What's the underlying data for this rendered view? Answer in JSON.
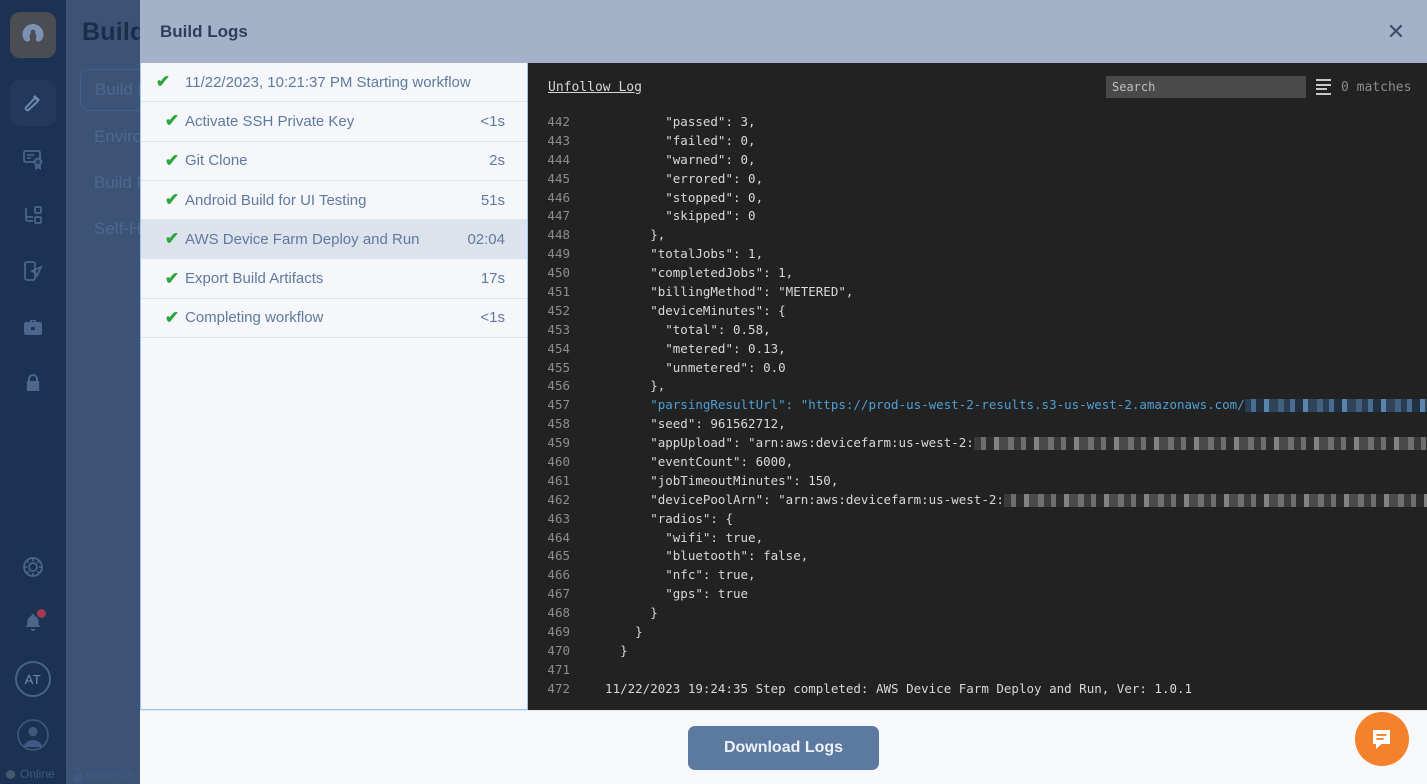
{
  "background": {
    "nav_title": "Build",
    "nav_items": [
      {
        "label": "Build Profiles",
        "name": "build-profiles"
      },
      {
        "label": "Environment Variables",
        "name": "environment-variables"
      },
      {
        "label": "Build History",
        "name": "build-history"
      },
      {
        "label": "Self-Hosted Runners",
        "name": "self-hosted-runners"
      }
    ],
    "rail_icons": [
      {
        "name": "appcircle-logo-icon"
      },
      {
        "name": "hammer-build-icon"
      },
      {
        "name": "signing-identities-icon"
      },
      {
        "name": "distribution-icon"
      },
      {
        "name": "testing-distribution-icon"
      },
      {
        "name": "enterprise-store-icon"
      },
      {
        "name": "security-lock-icon"
      },
      {
        "name": "settings-gear-icon"
      },
      {
        "name": "notifications-bell-icon"
      },
      {
        "name": "user-initials-avatar"
      },
      {
        "name": "account-avatar-icon"
      }
    ],
    "avatar_initials": "AT",
    "statusbar": {
      "online_label": "Online",
      "brand_label": "Appcircle"
    }
  },
  "modal": {
    "title": "Build Logs",
    "close_label": "✕",
    "footer": {
      "download_label": "Download Logs"
    }
  },
  "steps": [
    {
      "label": "11/22/2023, 10:21:37 PM Starting workflow",
      "duration": "",
      "header": true,
      "selected": false
    },
    {
      "label": "Activate SSH Private Key",
      "duration": "<1s",
      "header": false,
      "selected": false
    },
    {
      "label": "Git Clone",
      "duration": "2s",
      "header": false,
      "selected": false
    },
    {
      "label": "Android Build for UI Testing",
      "duration": "51s",
      "header": false,
      "selected": false
    },
    {
      "label": "AWS Device Farm Deploy and Run",
      "duration": "02:04",
      "header": false,
      "selected": true
    },
    {
      "label": "Export Build Artifacts",
      "duration": "17s",
      "header": false,
      "selected": false
    },
    {
      "label": "Completing workflow",
      "duration": "<1s",
      "header": false,
      "selected": false
    }
  ],
  "log_toolbar": {
    "unfollow_label": "Unfollow Log",
    "search_placeholder": "Search",
    "search_value": "",
    "match_count": "0 matches",
    "filter_icon": "filter-lines-icon"
  },
  "log_lines": [
    {
      "n": "442",
      "text": "          \"passed\": 3,"
    },
    {
      "n": "443",
      "text": "          \"failed\": 0,"
    },
    {
      "n": "444",
      "text": "          \"warned\": 0,"
    },
    {
      "n": "445",
      "text": "          \"errored\": 0,"
    },
    {
      "n": "446",
      "text": "          \"stopped\": 0,"
    },
    {
      "n": "447",
      "text": "          \"skipped\": 0"
    },
    {
      "n": "448",
      "text": "        },"
    },
    {
      "n": "449",
      "text": "        \"totalJobs\": 1,"
    },
    {
      "n": "450",
      "text": "        \"completedJobs\": 1,"
    },
    {
      "n": "451",
      "text": "        \"billingMethod\": \"METERED\","
    },
    {
      "n": "452",
      "text": "        \"deviceMinutes\": {"
    },
    {
      "n": "453",
      "text": "          \"total\": 0.58,"
    },
    {
      "n": "454",
      "text": "          \"metered\": 0.13,"
    },
    {
      "n": "455",
      "text": "          \"unmetered\": 0.0"
    },
    {
      "n": "456",
      "text": "        },"
    },
    {
      "n": "457",
      "text": "        \"parsingResultUrl\": \"https://prod-us-west-2-results.s3-us-west-2.amazonaws.com/",
      "url": true,
      "redacted": 300,
      "redacted_blue": true
    },
    {
      "n": "458",
      "text": "        \"seed\": 961562712,"
    },
    {
      "n": "459",
      "text": "        \"appUpload\": \"arn:aws:devicefarm:us-west-2:",
      "redacted": 460
    },
    {
      "n": "460",
      "text": "        \"eventCount\": 6000,"
    },
    {
      "n": "461",
      "text": "        \"jobTimeoutMinutes\": 150,"
    },
    {
      "n": "462",
      "text": "        \"devicePoolArn\": \"arn:aws:devicefarm:us-west-2:",
      "redacted": 430
    },
    {
      "n": "463",
      "text": "        \"radios\": {"
    },
    {
      "n": "464",
      "text": "          \"wifi\": true,"
    },
    {
      "n": "465",
      "text": "          \"bluetooth\": false,"
    },
    {
      "n": "466",
      "text": "          \"nfc\": true,"
    },
    {
      "n": "467",
      "text": "          \"gps\": true"
    },
    {
      "n": "468",
      "text": "        }"
    },
    {
      "n": "469",
      "text": "      }"
    },
    {
      "n": "470",
      "text": "    }"
    },
    {
      "n": "471",
      "text": ""
    },
    {
      "n": "472",
      "text": "  11/22/2023 19:24:35 Step completed: AWS Device Farm Deploy and Run, Ver: 1.0.1"
    }
  ],
  "colors": {
    "accent_blue": "#5c79a0",
    "success_green": "#2fa540",
    "chat_orange": "#f4822d",
    "log_background": "#222222",
    "url_blue": "#4f9fd4"
  }
}
